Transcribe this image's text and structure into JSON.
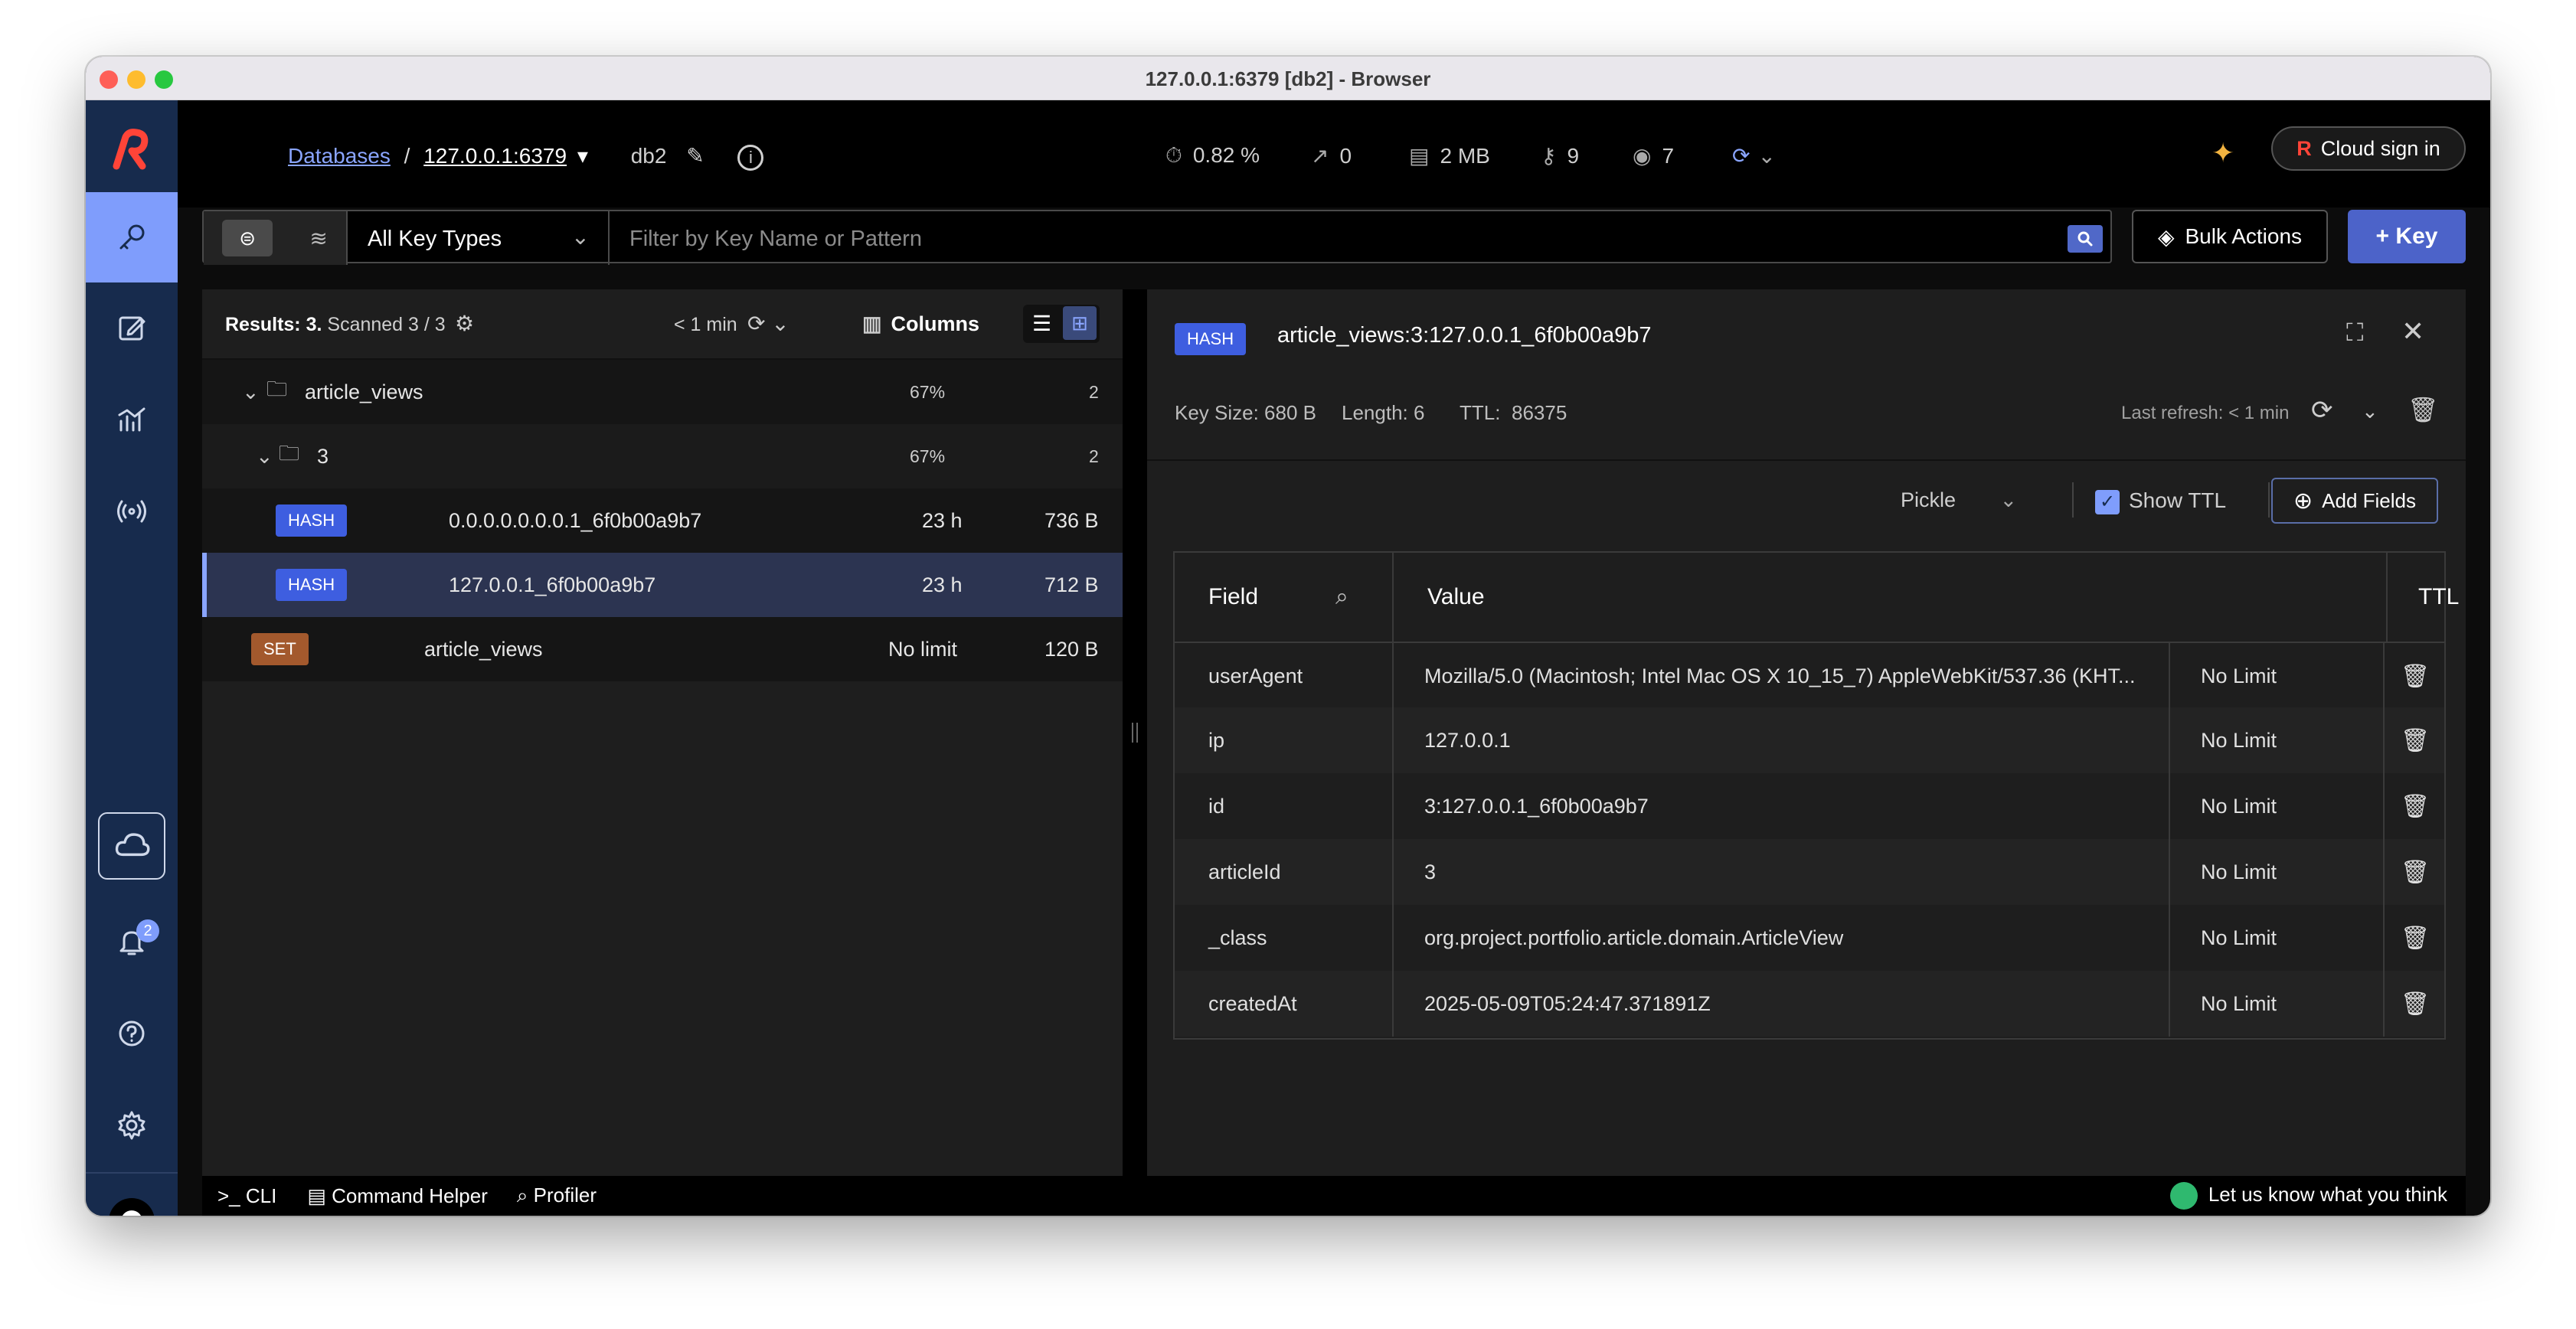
{
  "window": {
    "title": "127.0.0.1:6379 [db2] - Browser"
  },
  "breadcrumb": {
    "databases": "Databases",
    "separator": "/",
    "host": "127.0.0.1:6379",
    "db": "db2"
  },
  "stats": {
    "cpu": "0.82 %",
    "ops": "0",
    "memory": "2 MB",
    "keys": "9",
    "clients": "7"
  },
  "header": {
    "cloud_signin": "Cloud sign in"
  },
  "sidebar": {
    "notifications_badge": "2"
  },
  "filter": {
    "key_type": "All Key Types",
    "placeholder": "Filter by Key Name or Pattern",
    "bulk_actions": "Bulk Actions",
    "add_key": "+ Key"
  },
  "results": {
    "summary_bold": "Results: 3.",
    "summary_rest": "Scanned 3 / 3",
    "refresh": "< 1 min",
    "columns": "Columns"
  },
  "tree": [
    {
      "type": "folder",
      "name": "article_views",
      "pct": "67%",
      "count": "2"
    },
    {
      "type": "folder",
      "name": "3",
      "pct": "67%",
      "count": "2"
    },
    {
      "type": "HASH",
      "name": "0.0.0.0.0.0.0.1_6f0b00a9b7",
      "ttl": "23 h",
      "size": "736 B"
    },
    {
      "type": "HASH",
      "name": "127.0.0.1_6f0b00a9b7",
      "ttl": "23 h",
      "size": "712 B"
    },
    {
      "type": "SET",
      "name": "article_views",
      "ttl": "No limit",
      "size": "120 B"
    }
  ],
  "key": {
    "type": "HASH",
    "name": "article_views:3:127.0.0.1_6f0b00a9b7",
    "size_label": "Key Size: 680 B",
    "length_label": "Length: 6",
    "ttl_label": "TTL:",
    "ttl_value": "86375",
    "last_refresh": "Last refresh: < 1 min",
    "format": "Pickle",
    "show_ttl": "Show TTL",
    "add_fields": "Add Fields"
  },
  "table": {
    "headers": {
      "field": "Field",
      "value": "Value",
      "ttl": "TTL"
    },
    "rows": [
      {
        "field": "userAgent",
        "value": "Mozilla/5.0 (Macintosh; Intel Mac OS X 10_15_7) AppleWebKit/537.36 (KHT...",
        "ttl": "No Limit"
      },
      {
        "field": "ip",
        "value": "127.0.0.1",
        "ttl": "No Limit"
      },
      {
        "field": "id",
        "value": "3:127.0.0.1_6f0b00a9b7",
        "ttl": "No Limit"
      },
      {
        "field": "articleId",
        "value": "3",
        "ttl": "No Limit"
      },
      {
        "field": "_class",
        "value": "org.project.portfolio.article.domain.ArticleView",
        "ttl": "No Limit"
      },
      {
        "field": "createdAt",
        "value": "2025-05-09T05:24:47.371891Z",
        "ttl": "No Limit"
      }
    ]
  },
  "bottom": {
    "cli": ">_ CLI",
    "command_helper": "Command Helper",
    "profiler": "Profiler",
    "feedback": "Let us know what you think"
  },
  "colors": {
    "accent": "#7f9dfc",
    "sidebar": "#172b4d",
    "hash": "#3e5ee0",
    "set": "#a3592d",
    "primary_button": "#4c63c9"
  }
}
